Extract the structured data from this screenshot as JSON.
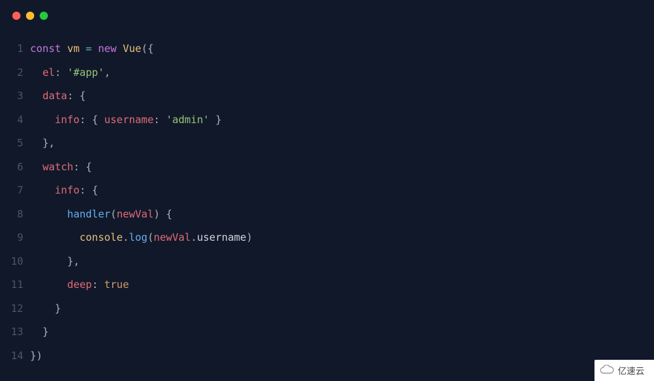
{
  "window": {
    "traffic_lights": [
      "close",
      "minimize",
      "maximize"
    ]
  },
  "code": {
    "lines": [
      {
        "n": 1,
        "tokens": [
          [
            "kw",
            "const"
          ],
          [
            "plain",
            " "
          ],
          [
            "var",
            "vm"
          ],
          [
            "plain",
            " "
          ],
          [
            "op",
            "="
          ],
          [
            "plain",
            " "
          ],
          [
            "kw",
            "new"
          ],
          [
            "plain",
            " "
          ],
          [
            "class",
            "Vue"
          ],
          [
            "punc",
            "("
          ],
          [
            "punc",
            "{"
          ]
        ]
      },
      {
        "n": 2,
        "tokens": [
          [
            "plain",
            "  "
          ],
          [
            "prop",
            "el"
          ],
          [
            "punc",
            ":"
          ],
          [
            "plain",
            " "
          ],
          [
            "str",
            "'#app'"
          ],
          [
            "punc",
            ","
          ]
        ]
      },
      {
        "n": 3,
        "tokens": [
          [
            "plain",
            "  "
          ],
          [
            "prop",
            "data"
          ],
          [
            "punc",
            ":"
          ],
          [
            "plain",
            " "
          ],
          [
            "punc",
            "{"
          ]
        ]
      },
      {
        "n": 4,
        "tokens": [
          [
            "plain",
            "    "
          ],
          [
            "prop",
            "info"
          ],
          [
            "punc",
            ":"
          ],
          [
            "plain",
            " "
          ],
          [
            "punc",
            "{"
          ],
          [
            "plain",
            " "
          ],
          [
            "prop",
            "username"
          ],
          [
            "punc",
            ":"
          ],
          [
            "plain",
            " "
          ],
          [
            "str",
            "'admin'"
          ],
          [
            "plain",
            " "
          ],
          [
            "punc",
            "}"
          ]
        ]
      },
      {
        "n": 5,
        "tokens": [
          [
            "plain",
            "  "
          ],
          [
            "punc",
            "},"
          ]
        ]
      },
      {
        "n": 6,
        "tokens": [
          [
            "plain",
            "  "
          ],
          [
            "prop",
            "watch"
          ],
          [
            "punc",
            ":"
          ],
          [
            "plain",
            " "
          ],
          [
            "punc",
            "{"
          ]
        ]
      },
      {
        "n": 7,
        "tokens": [
          [
            "plain",
            "    "
          ],
          [
            "prop",
            "info"
          ],
          [
            "punc",
            ":"
          ],
          [
            "plain",
            " "
          ],
          [
            "punc",
            "{"
          ]
        ]
      },
      {
        "n": 8,
        "tokens": [
          [
            "plain",
            "      "
          ],
          [
            "func",
            "handler"
          ],
          [
            "punc",
            "("
          ],
          [
            "param",
            "newVal"
          ],
          [
            "punc",
            ")"
          ],
          [
            "plain",
            " "
          ],
          [
            "punc",
            "{"
          ]
        ]
      },
      {
        "n": 9,
        "tokens": [
          [
            "plain",
            "        "
          ],
          [
            "obj",
            "console"
          ],
          [
            "punc",
            "."
          ],
          [
            "func",
            "log"
          ],
          [
            "punc",
            "("
          ],
          [
            "param",
            "newVal"
          ],
          [
            "punc",
            "."
          ],
          [
            "plain",
            "username"
          ],
          [
            "punc",
            ")"
          ]
        ]
      },
      {
        "n": 10,
        "tokens": [
          [
            "plain",
            "      "
          ],
          [
            "punc",
            "},"
          ]
        ]
      },
      {
        "n": 11,
        "tokens": [
          [
            "plain",
            "      "
          ],
          [
            "prop",
            "deep"
          ],
          [
            "punc",
            ":"
          ],
          [
            "plain",
            " "
          ],
          [
            "bool",
            "true"
          ]
        ]
      },
      {
        "n": 12,
        "tokens": [
          [
            "plain",
            "    "
          ],
          [
            "punc",
            "}"
          ]
        ]
      },
      {
        "n": 13,
        "tokens": [
          [
            "plain",
            "  "
          ],
          [
            "punc",
            "}"
          ]
        ]
      },
      {
        "n": 14,
        "tokens": [
          [
            "punc",
            "})"
          ]
        ]
      }
    ]
  },
  "watermark": {
    "text": "亿速云"
  }
}
